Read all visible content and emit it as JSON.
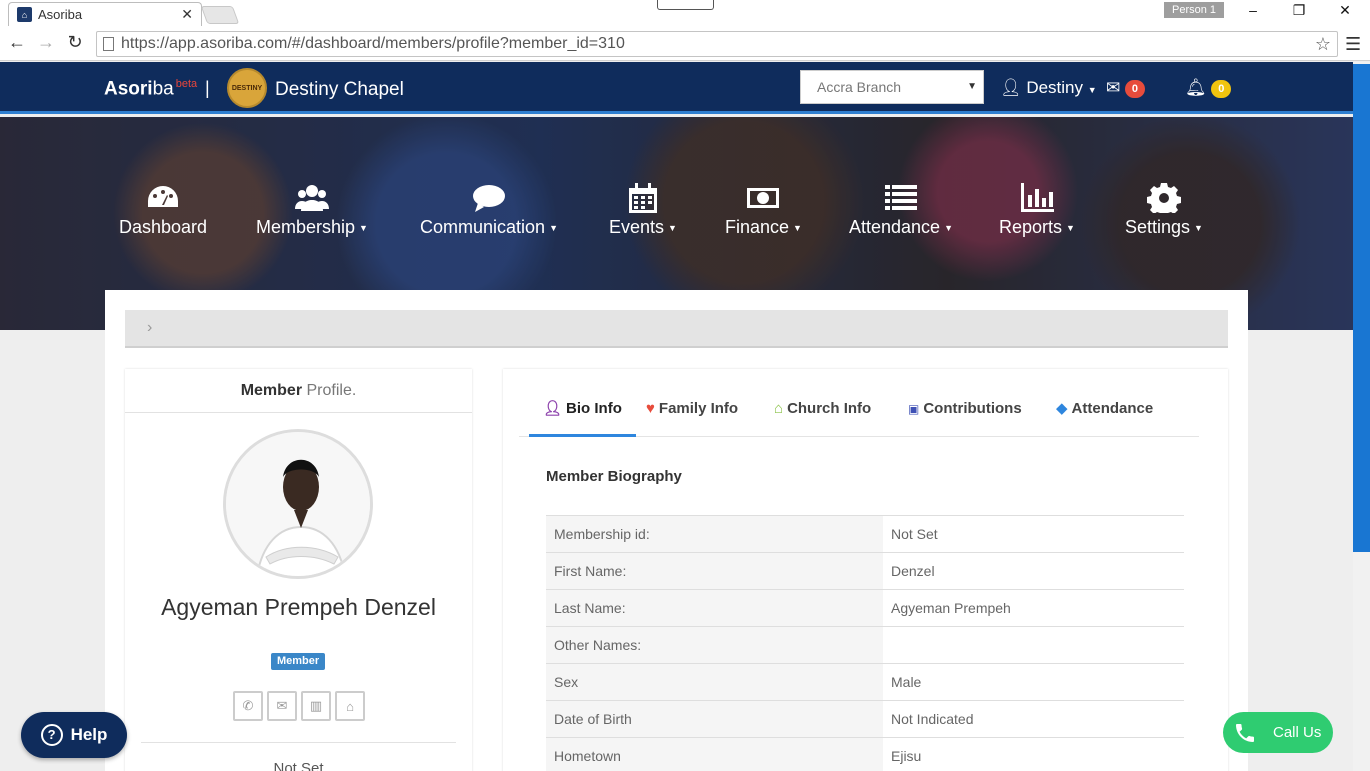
{
  "browser": {
    "tab_title": "Asoriba",
    "url": "https://app.asoriba.com/#/dashboard/members/profile?member_id=310",
    "profile_label": "Person 1"
  },
  "header": {
    "brand_bold": "Asori",
    "brand_rest": "ba",
    "brand_tag": "beta",
    "separator": "|",
    "church_logo_text": "DESTINY",
    "church_name": "Destiny Chapel",
    "branch_selected": "Accra Branch",
    "user_name": "Destiny",
    "messages_count": "0",
    "notifications_count": "0"
  },
  "nav": {
    "items": [
      {
        "label": "Dashboard",
        "icon": "dashboard-icon",
        "dropdown": false
      },
      {
        "label": "Membership",
        "icon": "users-icon",
        "dropdown": true
      },
      {
        "label": "Communication",
        "icon": "chat-icon",
        "dropdown": true
      },
      {
        "label": "Events",
        "icon": "calendar-icon",
        "dropdown": true
      },
      {
        "label": "Finance",
        "icon": "money-icon",
        "dropdown": true
      },
      {
        "label": "Attendance",
        "icon": "list-icon",
        "dropdown": true
      },
      {
        "label": "Reports",
        "icon": "bar-chart-icon",
        "dropdown": true
      },
      {
        "label": "Settings",
        "icon": "gear-icon",
        "dropdown": true
      }
    ]
  },
  "profile": {
    "title_bold": "Member",
    "title_light": "Profile.",
    "name": "Agyeman Prempeh Denzel",
    "role": "Member",
    "next_value": "Not Set"
  },
  "tabs": [
    {
      "label": "Bio Info",
      "icon": "user-icon",
      "color": "#8e44ad",
      "active": true
    },
    {
      "label": "Family Info",
      "icon": "heart-icon",
      "color": "#e74c3c",
      "active": false
    },
    {
      "label": "Church Info",
      "icon": "bank-icon",
      "color": "#8bc34a",
      "active": false
    },
    {
      "label": "Contributions",
      "icon": "money-icon",
      "color": "#3f51b5",
      "active": false
    },
    {
      "label": "Attendance",
      "icon": "tag-icon",
      "color": "#2e86de",
      "active": false
    }
  ],
  "biography": {
    "heading": "Member Biography",
    "rows": [
      {
        "key": "Membership id:",
        "value": "Not Set"
      },
      {
        "key": "First Name:",
        "value": "Denzel"
      },
      {
        "key": "Last Name:",
        "value": "Agyeman Prempeh"
      },
      {
        "key": "Other Names:",
        "value": ""
      },
      {
        "key": "Sex",
        "value": "Male"
      },
      {
        "key": "Date of Birth",
        "value": "Not Indicated"
      },
      {
        "key": "Hometown",
        "value": "Ejisu"
      }
    ]
  },
  "floating": {
    "help_label": "Help",
    "call_label": "Call Us"
  },
  "colors": {
    "navbar": "#0f2c5c",
    "accent": "#2e86de",
    "call": "#2fcc71"
  }
}
